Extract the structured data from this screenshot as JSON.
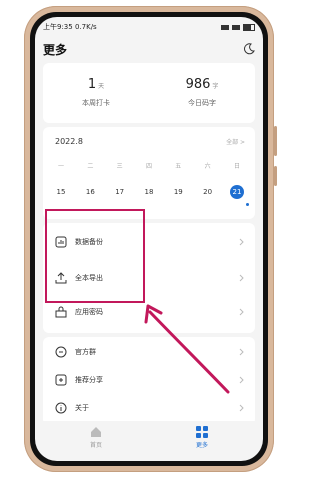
{
  "status_bar": {
    "time": "上午9:35",
    "speed": "0.7K/s"
  },
  "header": {
    "title": "更多"
  },
  "stats": [
    {
      "value": "1",
      "unit": "天",
      "label": "本周打卡"
    },
    {
      "value": "986",
      "unit": "字",
      "label": "今日码字"
    }
  ],
  "calendar": {
    "month": "2022.8",
    "view_all": "全部 >",
    "weekdays": [
      "一",
      "二",
      "三",
      "四",
      "五",
      "六",
      "日"
    ],
    "dates": [
      "15",
      "16",
      "17",
      "18",
      "19",
      "20",
      "21"
    ],
    "today": "21"
  },
  "menu_group_1": [
    {
      "label": "数据备份",
      "icon": "chart-icon"
    },
    {
      "label": "全本导出",
      "icon": "export-icon"
    },
    {
      "label": "应用密码",
      "icon": "lock-icon"
    }
  ],
  "menu_group_2": [
    {
      "label": "官方群",
      "icon": "group-icon"
    },
    {
      "label": "推荐分享",
      "icon": "share-icon"
    },
    {
      "label": "关于",
      "icon": "info-icon"
    }
  ],
  "bottom_nav": [
    {
      "label": "首页",
      "icon": "home-icon",
      "active": false
    },
    {
      "label": "更多",
      "icon": "grid-icon",
      "active": true
    }
  ],
  "colors": {
    "accent": "#1f6fd1",
    "highlight": "#c2185b",
    "phone_frame": "#d9b89c"
  }
}
